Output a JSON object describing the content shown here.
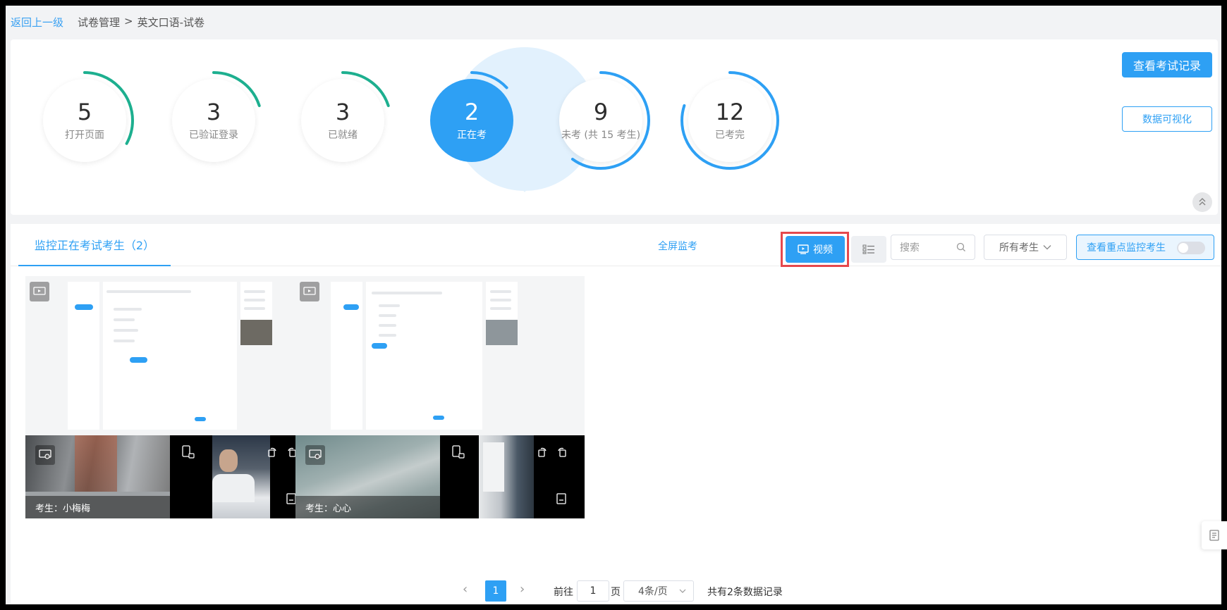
{
  "breadcrumb": {
    "back": "返回上一级",
    "path": [
      "试卷管理",
      ">",
      "英文口语-试卷"
    ]
  },
  "stats": [
    {
      "count": "5",
      "label": "打开页面",
      "progress": 0.33,
      "color": "#1daf8f"
    },
    {
      "count": "3",
      "label": "已验证登录",
      "progress": 0.2,
      "color": "#1daf8f"
    },
    {
      "count": "3",
      "label": "已就绪",
      "progress": 0.2,
      "color": "#1daf8f"
    },
    {
      "count": "2",
      "label": "正在考",
      "progress": 0.13,
      "color": "#2ea0f4",
      "active": true
    },
    {
      "count": "9",
      "label": "未考 (共 15 考生)",
      "progress": 0.6,
      "color": "#2ea0f4"
    },
    {
      "count": "12",
      "label": "已考完",
      "progress": 0.8,
      "color": "#2ea0f4"
    }
  ],
  "actions": {
    "records": "查看考试记录",
    "visualize": "数据可视化"
  },
  "monitor": {
    "tab": "监控正在考试考生（2）",
    "fullscreen": "全屏监考",
    "video": "视频",
    "search_placeholder": "搜索",
    "filter": "所有考生",
    "focus": "查看重点监控考生"
  },
  "candidates": [
    {
      "name": "考生：小梅梅"
    },
    {
      "name": "考生：心心"
    }
  ],
  "pagination": {
    "current": "1",
    "goto": "前往",
    "page_input": "1",
    "page_unit": "页",
    "page_size": "4条/页",
    "total": "共有2条数据记录"
  },
  "colors": {
    "accent": "#2ea0f4",
    "green": "#1daf8f",
    "highlight": "#e5484d"
  }
}
